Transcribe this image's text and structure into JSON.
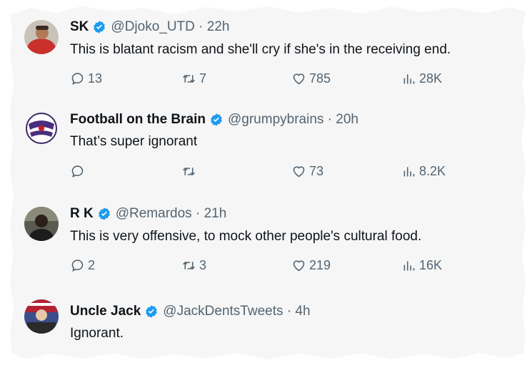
{
  "tweets": [
    {
      "name": "SK",
      "handle": "@Djoko_UTD",
      "time": "22h",
      "text": "This is blatant racism and she'll cry if she's in the receiving end.",
      "replies": "13",
      "retweets": "7",
      "likes": "785",
      "views": "28K"
    },
    {
      "name": "Football on the Brain",
      "handle": "@grumpybrains",
      "time": "20h",
      "text": "That’s super ignorant",
      "replies": "",
      "retweets": "",
      "likes": "73",
      "views": "8.2K"
    },
    {
      "name": "R K",
      "handle": "@Remardos",
      "time": "21h",
      "text": "This is very offensive, to mock other people's cultural food.",
      "replies": "2",
      "retweets": "3",
      "likes": "219",
      "views": "16K"
    },
    {
      "name": "Uncle Jack",
      "handle": "@JackDentsTweets",
      "time": "4h",
      "text": "Ignorant."
    }
  ],
  "colors": {
    "verified_badge": "#1d9bf0",
    "secondary_text": "#536471",
    "primary_text": "#0f1419"
  },
  "icons": [
    "reply-icon",
    "retweet-icon",
    "like-icon",
    "views-icon",
    "verified-badge-icon"
  ]
}
